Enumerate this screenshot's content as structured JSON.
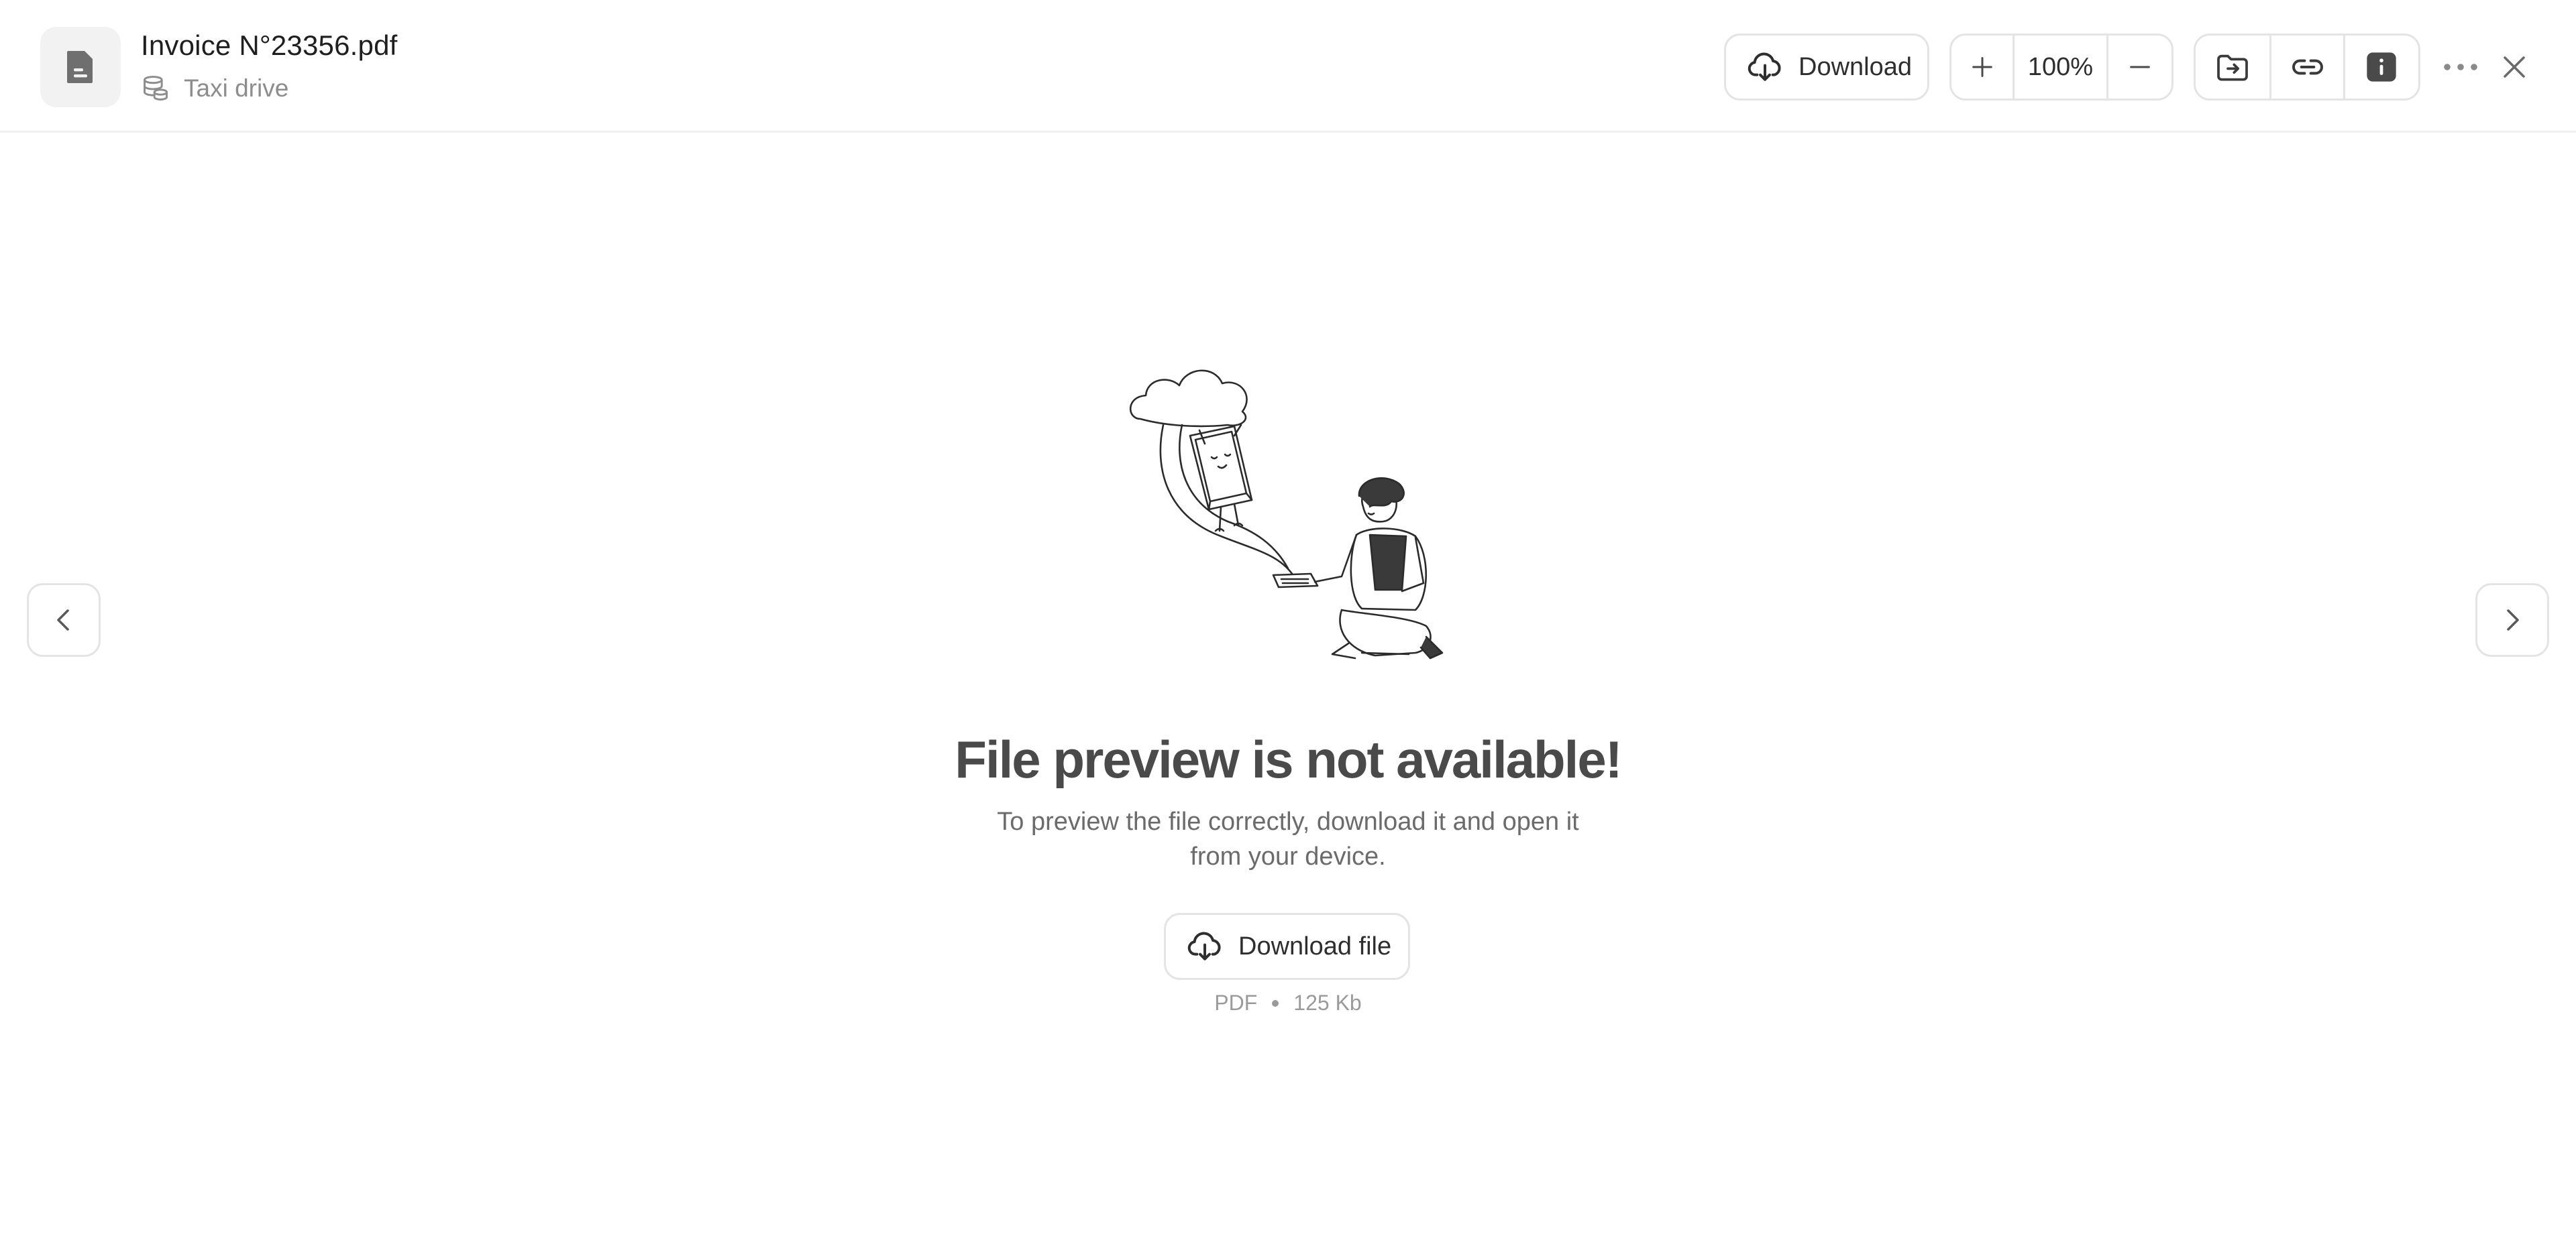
{
  "header": {
    "file_name": "Invoice N°23356.pdf",
    "location": "Taxi drive",
    "download_label": "Download",
    "zoom_value": "100%"
  },
  "icons": {
    "file": "file-document-icon",
    "location": "database-stack-icon",
    "download": "cloud-download-icon",
    "zoom_in": "plus-icon",
    "zoom_out": "minus-icon",
    "move": "folder-move-icon",
    "link": "link-icon",
    "info": "info-icon",
    "more": "more-horizontal-icon",
    "close": "close-icon",
    "prev": "chevron-left-icon",
    "next": "chevron-right-icon"
  },
  "empty_state": {
    "title": "File preview is not available!",
    "description": "To preview the file correctly, download it and open it from your device.",
    "button_label": "Download file",
    "file_type": "PDF",
    "file_size": "125 Kb"
  },
  "colors": {
    "text_primary": "#1f1f1f",
    "text_secondary": "#8d8d8d",
    "border": "#e4e4e4",
    "badge_bg": "#f2f2f2"
  }
}
